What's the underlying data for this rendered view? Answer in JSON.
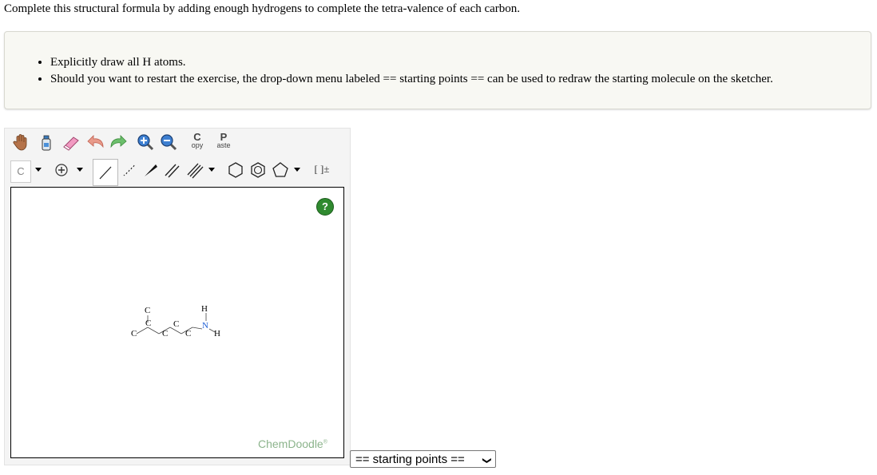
{
  "prompt": "Complete this structural formula by adding enough hydrogens to complete the tetra-valence of each carbon.",
  "instructions": [
    "Explicitly draw all H atoms.",
    "Should you want to restart the exercise, the drop-down menu labeled == starting points == can be used to redraw the starting molecule on the sketcher."
  ],
  "toolbar": {
    "copy_big": "C",
    "copy_small": "opy",
    "paste_big": "P",
    "paste_small": "aste",
    "atom_label": "C",
    "bracket_label": "[ ]±"
  },
  "canvas": {
    "help_label": "?",
    "brand": "ChemDoodle",
    "brand_mark": "®"
  },
  "molecule": {
    "atoms": [
      "C",
      "C",
      "C",
      "C",
      "C",
      "C",
      "N",
      "H",
      "H"
    ]
  },
  "starting_points": {
    "selected": "== starting points =="
  },
  "colors": {
    "nitrogen": "#1f5fd6",
    "help": "#2f8a2f",
    "brand": "#8cb48c"
  }
}
